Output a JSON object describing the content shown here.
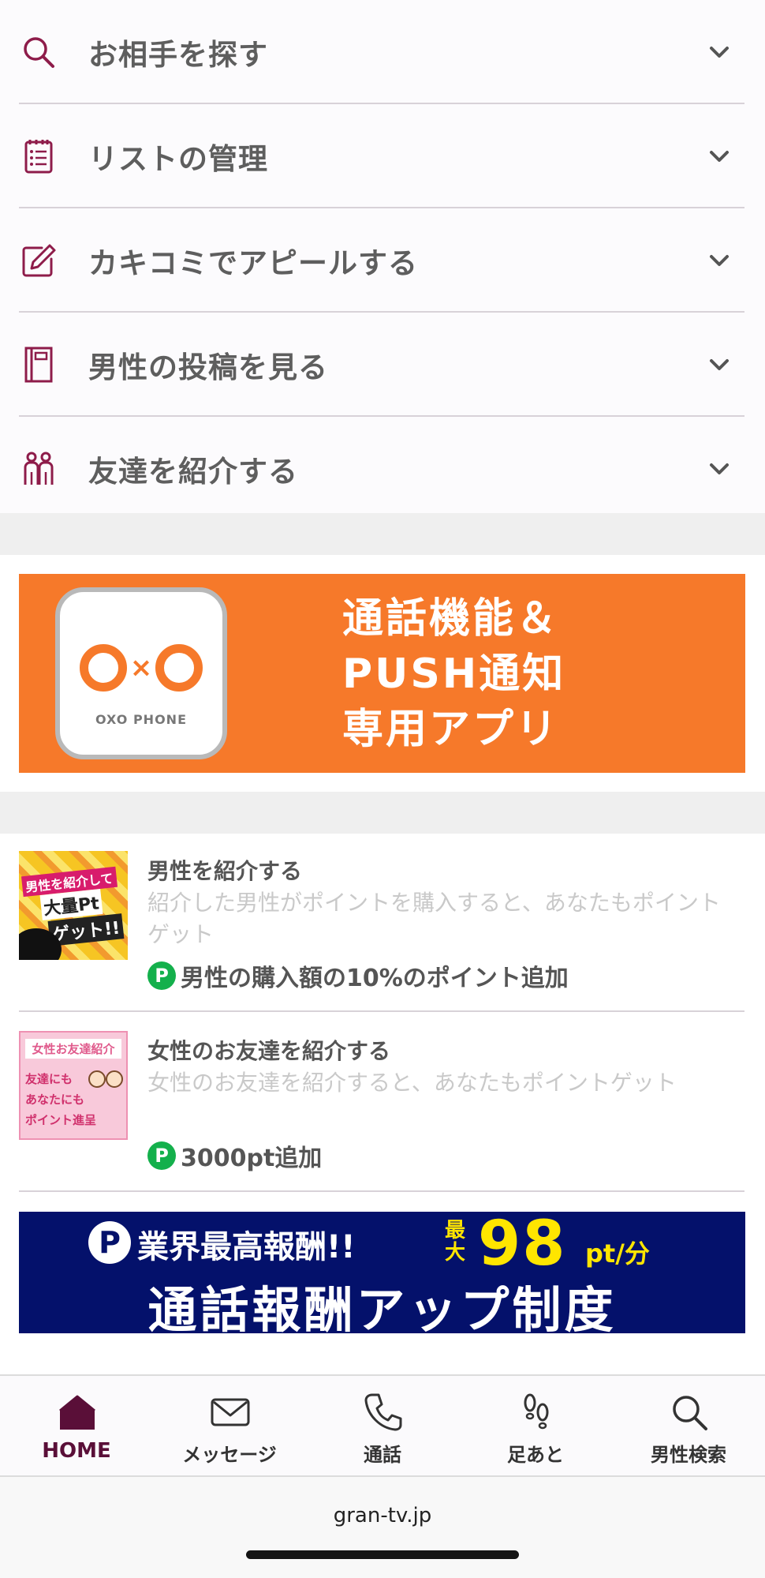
{
  "menu": {
    "items": [
      {
        "label": "お相手を探す",
        "icon": "search-icon"
      },
      {
        "label": "リストの管理",
        "icon": "list-icon"
      },
      {
        "label": "カキコミでアピールする",
        "icon": "pencil-edit-icon"
      },
      {
        "label": "男性の投稿を見る",
        "icon": "notebook-icon"
      },
      {
        "label": "友達を紹介する",
        "icon": "people-icon"
      }
    ]
  },
  "oxo_banner": {
    "app_logo_text": "O×O",
    "app_name": "OXO PHONE",
    "lines": [
      "通話機能＆",
      "PUSH通知",
      "専用アプリ"
    ],
    "background": "#f6792a"
  },
  "invites": [
    {
      "title": "男性を紹介する",
      "description": "紹介した男性がポイントを購入すると、あなたもポイントゲット",
      "reward": "男性の購入額の10%のポイント追加",
      "thumb_lines": [
        "男性を紹介して",
        "大量Pt",
        "ゲット!!"
      ]
    },
    {
      "title": "女性のお友達を紹介する",
      "description": "女性のお友達を紹介すると、あなたもポイントゲット",
      "reward": "3000pt追加",
      "thumb_lines": [
        "女性お友達紹介",
        "友達にも",
        "あなたにも",
        "ポイント進呈"
      ]
    }
  ],
  "reward_badge_letter": "P",
  "reward_banner": {
    "badge": "P",
    "line1": "業界最高報酬!!",
    "max_label": "最大",
    "amount": "98",
    "unit": "pt/分",
    "line2": "通話報酬アップ制度",
    "background": "#04116b",
    "accent": "#ffe500"
  },
  "tabbar": {
    "tabs": [
      {
        "label": "HOME",
        "icon": "home-icon",
        "active": true
      },
      {
        "label": "メッセージ",
        "icon": "envelope-icon",
        "active": false
      },
      {
        "label": "通話",
        "icon": "phone-icon",
        "active": false
      },
      {
        "label": "足あと",
        "icon": "footprints-icon",
        "active": false
      },
      {
        "label": "男性検索",
        "icon": "search-icon",
        "active": false
      }
    ],
    "active_color": "#5a0f38"
  },
  "browser": {
    "url": "gran-tv.jp"
  },
  "colors": {
    "brand": "#8e1c4a",
    "points_green": "#14b04c"
  }
}
